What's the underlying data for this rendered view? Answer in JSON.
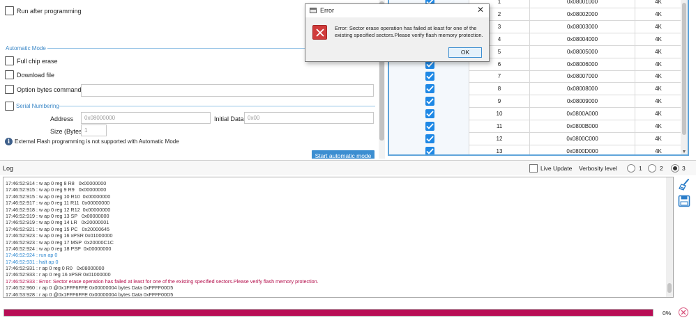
{
  "options": {
    "run_after_programming": "Run after programming",
    "automatic_mode_title": "Automatic Mode",
    "full_chip_erase": "Full chip erase",
    "download_file": "Download file",
    "option_bytes_commands": "Option bytes commands",
    "option_bytes_value": "",
    "serial_numbering": "Serial Numbering",
    "address_label": "Address",
    "address_placeholder": "0x08000000",
    "initial_data_label": "Initial Data",
    "initial_data_placeholder": "0x00",
    "size_label": "Size (Bytes)",
    "size_placeholder": "1",
    "info_text": "External Flash programming is not supported with Automatic Mode",
    "start_button": "Start automatic mode"
  },
  "sectors": [
    {
      "index": "1",
      "address": "0x08001000",
      "size": "4K",
      "checked": true
    },
    {
      "index": "2",
      "address": "0x08002000",
      "size": "4K",
      "checked": true
    },
    {
      "index": "3",
      "address": "0x08003000",
      "size": "4K",
      "checked": true
    },
    {
      "index": "4",
      "address": "0x08004000",
      "size": "4K",
      "checked": true
    },
    {
      "index": "5",
      "address": "0x08005000",
      "size": "4K",
      "checked": true
    },
    {
      "index": "6",
      "address": "0x08006000",
      "size": "4K",
      "checked": true
    },
    {
      "index": "7",
      "address": "0x08007000",
      "size": "4K",
      "checked": true
    },
    {
      "index": "8",
      "address": "0x08008000",
      "size": "4K",
      "checked": true
    },
    {
      "index": "9",
      "address": "0x08009000",
      "size": "4K",
      "checked": true
    },
    {
      "index": "10",
      "address": "0x0800A000",
      "size": "4K",
      "checked": true
    },
    {
      "index": "11",
      "address": "0x0800B000",
      "size": "4K",
      "checked": true
    },
    {
      "index": "12",
      "address": "0x0800C000",
      "size": "4K",
      "checked": true
    },
    {
      "index": "13",
      "address": "0x0800D000",
      "size": "4K",
      "checked": true
    }
  ],
  "dialog": {
    "title": "Error",
    "message": "Error: Sector erase operation has failed at least for one of the existing specified sectors.Please verify flash memory protection.",
    "ok_button": "OK"
  },
  "log": {
    "title": "Log",
    "live_update": "Live Update",
    "verbosity_label": "Verbosity level",
    "verbosity_levels": [
      "1",
      "2",
      "3"
    ],
    "verbosity_selected": "3",
    "lines": [
      {
        "text": "17:46:52:914 : w ap 0 reg 8 R8   0x00000000",
        "color": "normal"
      },
      {
        "text": "17:46:52:915 : w ap 0 reg 9 R9   0x00000000",
        "color": "normal"
      },
      {
        "text": "17:46:52:915 : w ap 0 reg 10 R10  0x00000000",
        "color": "normal"
      },
      {
        "text": "17:46:52:917 : w ap 0 reg 11 R11  0x00000000",
        "color": "normal"
      },
      {
        "text": "17:46:52:918 : w ap 0 reg 12 R12  0x00000000",
        "color": "normal"
      },
      {
        "text": "17:46:52:919 : w ap 0 reg 13 SP   0x00000000",
        "color": "normal"
      },
      {
        "text": "17:46:52:919 : w ap 0 reg 14 LR   0x20000001",
        "color": "normal"
      },
      {
        "text": "17:46:52:921 : w ap 0 reg 15 PC   0x20000645",
        "color": "normal"
      },
      {
        "text": "17:46:52:923 : w ap 0 reg 16 xPSR 0x01000000",
        "color": "normal"
      },
      {
        "text": "17:46:52:923 : w ap 0 reg 17 MSP  0x20000C1C",
        "color": "normal"
      },
      {
        "text": "17:46:52:924 : w ap 0 reg 18 PSP  0x00000000",
        "color": "normal"
      },
      {
        "text": "17:46:52:924 : run ap 0",
        "color": "blue"
      },
      {
        "text": "17:46:52:931 : halt ap 0",
        "color": "blue"
      },
      {
        "text": "17:46:52:931 : r ap 0 reg 0 R0   0x08000000",
        "color": "normal"
      },
      {
        "text": "17:46:52:933 : r ap 0 reg 16 xPSR 0x01000000",
        "color": "normal"
      },
      {
        "text": "17:46:52:933 : Error: Sector erase operation has failed at least for one of the existing specified sectors.Please verify flash memory protection.",
        "color": "red"
      },
      {
        "text": "17:46:52:960 : r ap 0 @0x1FFF6FFE 0x00000004 bytes Data 0xFFFF00D5",
        "color": "normal"
      },
      {
        "text": "17:46:53:928 : r ap 0 @0x1FFF6FFE 0x00000004 bytes Data 0xFFFF00D5",
        "color": "normal"
      }
    ]
  },
  "progress": {
    "value": 1.0,
    "label": "0%"
  },
  "colors": {
    "accent": "#3c8ed1",
    "progress": "#b80d55",
    "error_text": "#b40f4c",
    "info_text": "#2e88d0"
  }
}
